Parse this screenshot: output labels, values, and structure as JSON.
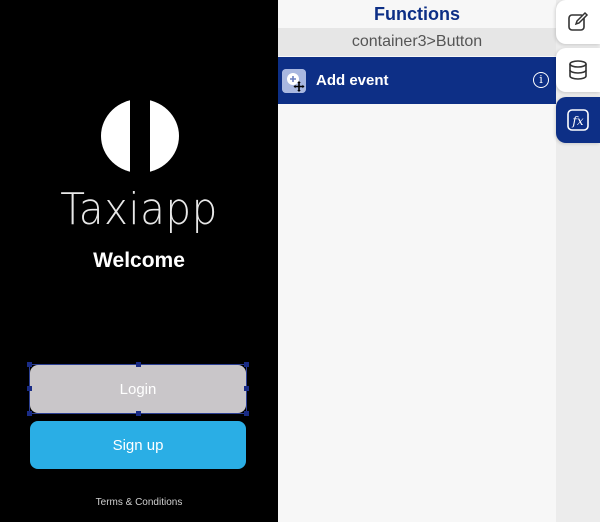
{
  "phone": {
    "app_name": "Taxiapp",
    "welcome": "Welcome",
    "login_label": "Login",
    "signup_label": "Sign up",
    "terms_label": "Terms & Conditions"
  },
  "panel": {
    "title": "Functions",
    "breadcrumb": "container3>Button",
    "add_event_label": "Add event",
    "info_symbol": "i"
  },
  "tabs": [
    {
      "icon": "edit-icon"
    },
    {
      "icon": "database-icon"
    },
    {
      "icon": "function-icon",
      "active": true
    }
  ],
  "colors": {
    "brand_navy": "#0d2f86",
    "signup_blue": "#2aaee5",
    "login_gray": "#c9c6c9"
  }
}
